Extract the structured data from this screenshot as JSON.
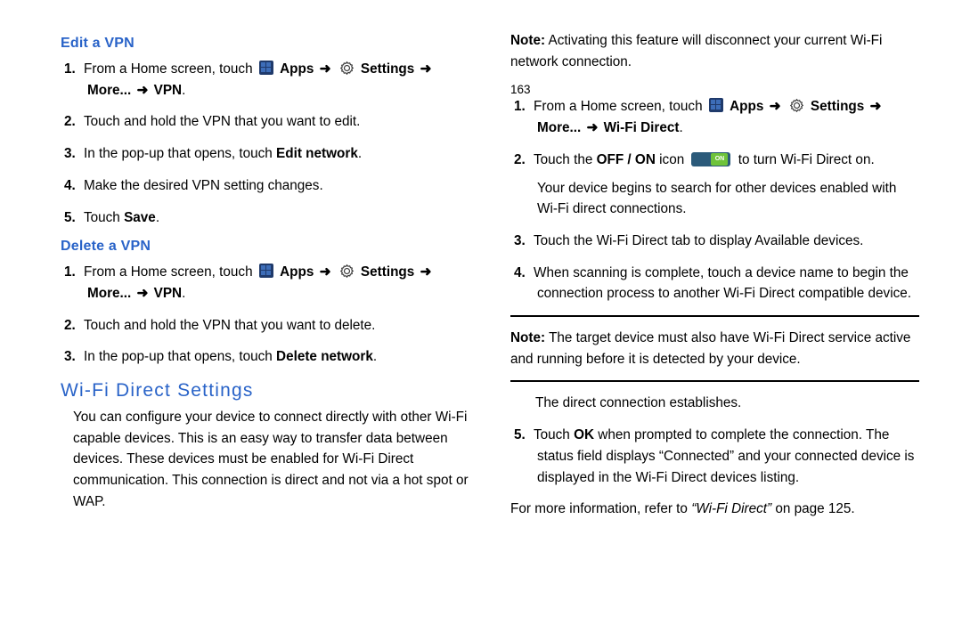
{
  "left": {
    "edit_vpn": {
      "title": "Edit a VPN",
      "s1a": "From a Home screen, touch ",
      "apps": "Apps",
      "settings": "Settings",
      "path_tail": "More... ",
      "vpn": "VPN",
      "s2": "Touch and hold the VPN that you want to edit.",
      "s3a": "In the pop-up that opens, touch ",
      "s3b": "Edit network",
      "s4": "Make the desired VPN setting changes.",
      "s5a": "Touch ",
      "s5b": "Save"
    },
    "delete_vpn": {
      "title": "Delete a VPN",
      "s1a": "From a Home screen, touch ",
      "s2": "Touch and hold the VPN that you want to delete.",
      "s3a": "In the pop-up that opens, touch ",
      "s3b": "Delete network"
    },
    "wifi": {
      "title": "Wi-Fi Direct Settings",
      "p1": "You can configure your device to connect directly with other Wi-Fi capable devices. This is an easy way to transfer data between devices. These devices must be enabled for Wi-Fi Direct communication. This connection is direct and not via a hot spot or WAP.",
      "note_label": "Note:",
      "note": " Activating this feature will disconnect your current Wi-Fi network connection."
    },
    "page": "163"
  },
  "right": {
    "s1a": "From a Home screen, touch ",
    "apps": "Apps",
    "settings": "Settings",
    "path_tail": "More... ",
    "wfd": "Wi-Fi Direct",
    "s2a": "Touch the ",
    "s2b": "OFF / ON",
    "s2c": " icon ",
    "s2d": " to turn Wi-Fi Direct on.",
    "s2e": "Your device begins to search for other devices enabled with Wi-Fi direct connections.",
    "s3": "Touch the Wi-Fi Direct tab to display Available devices.",
    "s4": "When scanning is complete, touch a device name to begin the connection process to another Wi-Fi Direct compatible device.",
    "note_label": "Note:",
    "note": " The target device must also have Wi-Fi Direct service active and running before it is detected by your device.",
    "after_note": "The direct connection establishes.",
    "s5a": "Touch ",
    "s5b": "OK",
    "s5c": " when prompted to complete the connection. The status field displays “Connected” and your connected device is displayed in the Wi-Fi Direct devices listing.",
    "more_a": "For more information, refer to ",
    "more_b": "“Wi-Fi Direct”",
    "more_c": "  on page 125."
  },
  "glyph": {
    "arrow": "➜"
  }
}
